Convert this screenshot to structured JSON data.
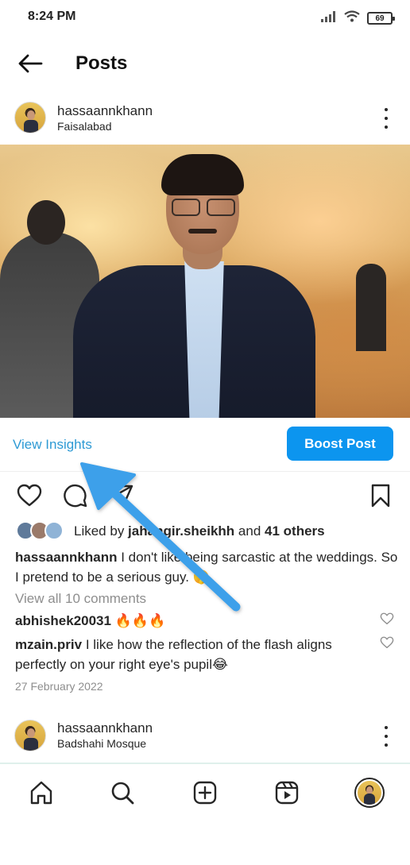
{
  "status_bar": {
    "time": "8:24 PM",
    "battery": "69",
    "icons": [
      "signal-icon",
      "wifi-icon",
      "battery-icon"
    ]
  },
  "header": {
    "back_icon": "arrow-left-icon",
    "title": "Posts"
  },
  "post": {
    "username": "hassaannkhann",
    "location": "Faisalabad",
    "image_description_icon": "photo",
    "view_insights": "View Insights",
    "boost_label": "Boost Post",
    "liked_by_prefix": "Liked by ",
    "liked_by_user": "jahangir.sheikhh",
    "liked_by_middle": " and ",
    "liked_by_others": "41 others",
    "caption_user": "hassaannkhann",
    "caption_text": " I don't like being sarcastic at the weddings. So I pretend to be a serious guy. 🤫",
    "view_comments": "View all 10 comments",
    "comments": [
      {
        "user": "abhishek20031",
        "text": " 🔥🔥🔥"
      },
      {
        "user": "mzain.priv",
        "text": " I like how the reflection of the flash aligns perfectly on your right eye's pupil😂"
      }
    ],
    "date": "27 February 2022"
  },
  "next_post": {
    "username": "hassaannkhann",
    "location": "Badshahi Mosque"
  },
  "bottom_nav": {
    "items": [
      "home-icon",
      "search-icon",
      "new-post-icon",
      "reels-icon",
      "profile-avatar"
    ]
  },
  "colors": {
    "accent_blue": "#0c95ef",
    "insights_blue": "#2e9ad4",
    "annotation_arrow": "#3ea0ea"
  }
}
